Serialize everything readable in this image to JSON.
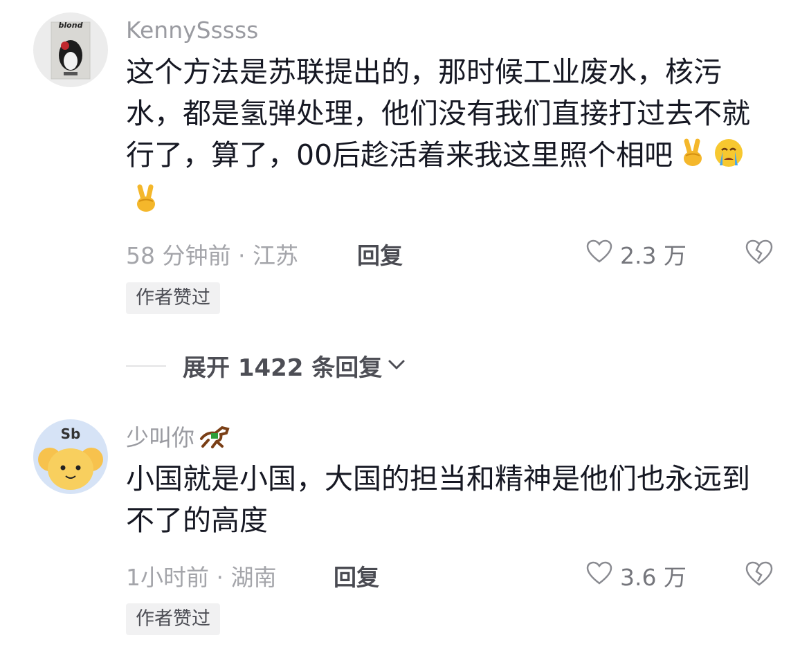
{
  "comments": [
    {
      "username": "KennySssss",
      "avatar_text": "blond",
      "text": "这个方法是苏联提出的，那时候工业废水，核污水，都是氢弹处理，他们没有我们直接打过去不就行了，算了，00后趁活着来我这里照个相吧",
      "emojis": [
        "victory-hand-emoji",
        "crying-face-emoji",
        "victory-hand-emoji"
      ],
      "time_location": "58 分钟前 · 江苏",
      "reply_label": "回复",
      "likes": "2.3 万",
      "badge": "作者赞过"
    },
    {
      "username": "少叫你",
      "username_emoji": "horse-emoji",
      "avatar_text": "Sb",
      "text": "小国就是小国，大国的担当和精神是他们也永远到不了的高度",
      "time_location": "1小时前 · 湖南",
      "reply_label": "回复",
      "likes": "3.6 万",
      "badge": "作者赞过"
    }
  ],
  "expand_replies": {
    "label": "展开 1422 条回复"
  },
  "colors": {
    "text": "#161823",
    "muted": "#9a9ba1",
    "badge_bg": "#f1f1f2"
  }
}
